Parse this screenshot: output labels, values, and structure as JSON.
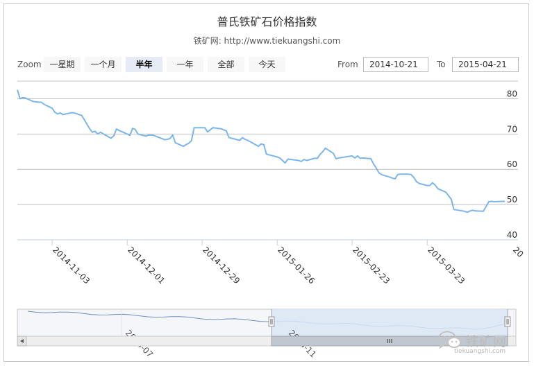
{
  "header": {
    "title": "普氏铁矿石价格指数",
    "subtitle": "铁矿网: http://www.tiekuangshi.com"
  },
  "toolbar": {
    "zoom_label": "Zoom",
    "buttons": [
      "一星期",
      "一个月",
      "半年",
      "一年",
      "全部",
      "今天"
    ],
    "active": "半年",
    "from_label": "From",
    "from_value": "2014-10-21",
    "to_label": "To",
    "to_value": "2015-04-21"
  },
  "watermark": {
    "text": "铁矿网",
    "url": "tiekuangshi.com"
  },
  "colors": {
    "series": "#7cb5ec",
    "grid": "#c0c0c0",
    "navigator_mask": "#dbe6f5"
  },
  "chart_data": {
    "type": "line",
    "title": "普氏铁矿石价格指数",
    "subtitle": "铁矿网: http://www.tiekuangshi.com",
    "xlabel": "",
    "ylabel": "",
    "ylim": [
      40,
      85
    ],
    "y_ticks": [
      40,
      50,
      60,
      70,
      80
    ],
    "xlim": [
      "2014-10-21",
      "2015-04-21"
    ],
    "x_ticks": [
      "2014-11-03",
      "2014-12-01",
      "2014-12-29",
      "2015-01-26",
      "2015-02-23",
      "2015-03-23"
    ],
    "x_tick_cut": "20",
    "grid": true,
    "legend": "none",
    "series": [
      {
        "x": [
          "2014-10-21",
          "2014-10-22",
          "2014-10-23",
          "2014-10-24",
          "2014-10-27",
          "2014-10-28",
          "2014-10-29",
          "2014-10-30",
          "2014-10-31",
          "2014-11-03",
          "2014-11-04",
          "2014-11-05",
          "2014-11-06",
          "2014-11-07",
          "2014-11-10",
          "2014-11-11",
          "2014-11-12",
          "2014-11-13",
          "2014-11-14",
          "2014-11-17",
          "2014-11-18",
          "2014-11-19",
          "2014-11-20",
          "2014-11-21",
          "2014-11-24",
          "2014-11-25",
          "2014-11-26",
          "2014-11-27",
          "2014-11-28",
          "2014-12-01",
          "2014-12-02",
          "2014-12-03",
          "2014-12-04",
          "2014-12-05",
          "2014-12-08",
          "2014-12-09",
          "2014-12-10",
          "2014-12-11",
          "2014-12-12",
          "2014-12-15",
          "2014-12-16",
          "2014-12-17",
          "2014-12-18",
          "2014-12-19",
          "2014-12-22",
          "2014-12-23",
          "2014-12-24",
          "2014-12-25",
          "2014-12-26",
          "2014-12-29",
          "2014-12-30",
          "2014-12-31",
          "2015-01-02",
          "2015-01-05",
          "2015-01-06",
          "2015-01-07",
          "2015-01-08",
          "2015-01-09",
          "2015-01-12",
          "2015-01-13",
          "2015-01-14",
          "2015-01-15",
          "2015-01-16",
          "2015-01-19",
          "2015-01-20",
          "2015-01-21",
          "2015-01-22",
          "2015-01-23",
          "2015-01-26",
          "2015-01-27",
          "2015-01-28",
          "2015-01-29",
          "2015-01-30",
          "2015-02-02",
          "2015-02-03",
          "2015-02-04",
          "2015-02-05",
          "2015-02-06",
          "2015-02-09",
          "2015-02-10",
          "2015-02-11",
          "2015-02-12",
          "2015-02-13",
          "2015-02-16",
          "2015-02-17",
          "2015-02-18",
          "2015-02-23",
          "2015-02-24",
          "2015-02-25",
          "2015-02-26",
          "2015-02-27",
          "2015-03-02",
          "2015-03-03",
          "2015-03-04",
          "2015-03-05",
          "2015-03-06",
          "2015-03-09",
          "2015-03-10",
          "2015-03-11",
          "2015-03-12",
          "2015-03-13",
          "2015-03-16",
          "2015-03-17",
          "2015-03-18",
          "2015-03-19",
          "2015-03-20",
          "2015-03-23",
          "2015-03-24",
          "2015-03-25",
          "2015-03-26",
          "2015-03-27",
          "2015-03-30",
          "2015-03-31",
          "2015-04-01",
          "2015-04-02",
          "2015-04-06",
          "2015-04-07",
          "2015-04-08",
          "2015-04-09",
          "2015-04-10",
          "2015-04-13",
          "2015-04-14",
          "2015-04-15",
          "2015-04-16",
          "2015-04-17",
          "2015-04-20",
          "2015-04-21"
        ],
        "values": [
          82.5,
          80.0,
          80.3,
          80.2,
          79.2,
          79.1,
          79.0,
          79.0,
          78.4,
          77.3,
          76.2,
          75.7,
          76.0,
          75.5,
          76.0,
          76.0,
          75.8,
          75.5,
          75.3,
          71.5,
          70.5,
          70.8,
          70.0,
          70.5,
          69.2,
          68.8,
          69.5,
          71.4,
          71.0,
          70.0,
          69.6,
          71.6,
          71.3,
          70.0,
          69.4,
          69.7,
          69.7,
          69.6,
          69.3,
          68.4,
          68.5,
          68.7,
          69.7,
          67.5,
          66.5,
          67.0,
          67.4,
          68.1,
          71.8,
          71.8,
          71.8,
          70.6,
          71.8,
          71.5,
          71.2,
          70.9,
          69.0,
          68.8,
          68.2,
          69.0,
          68.5,
          68.2,
          67.8,
          66.5,
          67.2,
          67.0,
          64.3,
          64.1,
          63.5,
          63.2,
          62.5,
          61.8,
          62.9,
          62.6,
          62.5,
          62.2,
          62.8,
          62.5,
          63.1,
          63.1,
          64.2,
          65.0,
          66.0,
          64.5,
          63.0,
          63.2,
          63.8,
          63.2,
          63.8,
          63.1,
          63.2,
          63.0,
          61.5,
          60.3,
          59.0,
          58.5,
          57.8,
          57.5,
          57.3,
          58.5,
          58.6,
          58.6,
          58.5,
          57.7,
          56.5,
          56.0,
          55.4,
          55.4,
          56.2,
          55.5,
          54.5,
          53.5,
          52.5,
          51.5,
          48.6,
          48.1,
          47.8,
          48.2,
          48.4,
          48.2,
          48.1,
          49.5,
          50.8,
          50.9,
          50.8,
          50.9,
          50.9
        ]
      }
    ],
    "navigator": {
      "x_ticks": [
        "2014-07",
        "2014-11"
      ],
      "selected_from": "2014-10-21",
      "selected_to": "2015-04-21"
    }
  }
}
